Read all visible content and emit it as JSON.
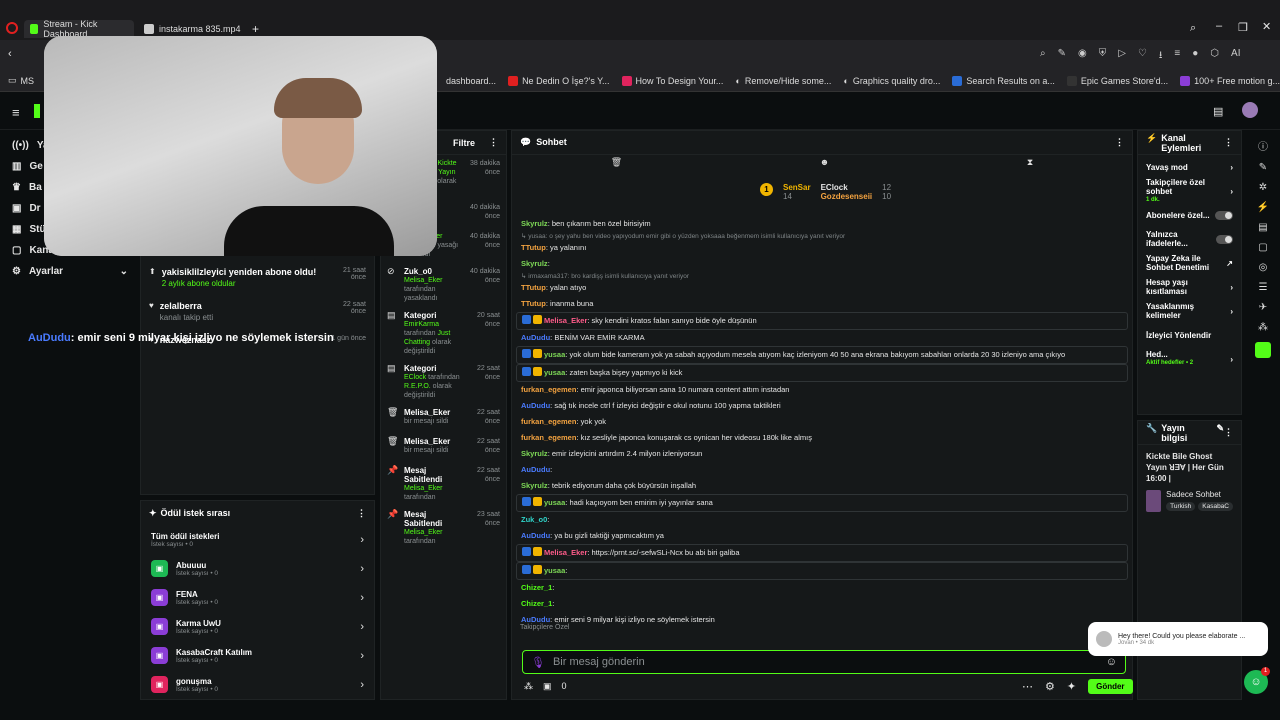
{
  "browser": {
    "tabs": [
      {
        "label": "Stream - Kick Dashboard",
        "active": true
      },
      {
        "label": "instakarma 835.mp4",
        "active": false
      }
    ],
    "bookmarks": [
      "MS",
      "dashboard...",
      "Ne Dedin O İşe?'s Y...",
      "How To Design Your...",
      "Remove/Hide some...",
      "Graphics quality dro...",
      "Search Results on a...",
      "Epic Games Store'd...",
      "100+ Free motion g..."
    ],
    "ai_label": "AI"
  },
  "leftnav": {
    "items": [
      {
        "label": "Ya",
        "icon": "broadcast-icon"
      },
      {
        "label": "Ge",
        "icon": "stats-icon"
      },
      {
        "label": "Ba",
        "icon": "trophy-icon"
      },
      {
        "label": "Dr",
        "icon": "drops-icon"
      },
      {
        "label": "Stü",
        "icon": "studio-icon"
      },
      {
        "label": "Kanal",
        "icon": "channel-icon"
      }
    ],
    "settings_label": "Ayarlar"
  },
  "overlay_caption": {
    "user": "AuDudu",
    "text": ": emir seni 9 milyar kişi izliyo ne söylemek istersin"
  },
  "activity_left": [
    {
      "name": "yakisiklilzleyici yeniden abone oldu!",
      "sub": "2 aylık abone oldular",
      "time": "21 saat önce",
      "icon": "subscribe-icon"
    },
    {
      "name": "zelalberra",
      "sub": "kanalı takip etti",
      "time": "22 saat önce",
      "icon": "heart-icon"
    },
    {
      "name": "nazweznasz",
      "sub": "",
      "time": "1 gün önce",
      "icon": "heart-icon"
    }
  ],
  "modlog": {
    "filter_label": "Filtre",
    "entries": [
      {
        "title": "",
        "by": "",
        "action": "tarafından",
        "target": "Kickte Bile Ghost Yayın ꓤƎⱯ | Her",
        "extra": "olarak değiştirildi",
        "time": "38 dakika önce"
      },
      {
        "title": "",
        "by": "",
        "action": "",
        "target": "",
        "extra": "",
        "time": "40 dakika önce"
      },
      {
        "title": "",
        "by": "Melisa_Eker",
        "action": "tarafından yasağı",
        "target": "",
        "extra": "kaldırıldı",
        "time": "40 dakika önce"
      },
      {
        "title": "Zuk_o0",
        "by": "Melisa_Eker",
        "action": "tarafından",
        "target": "",
        "extra": "yasaklandı",
        "time": "40 dakika önce",
        "icon": "ban-icon"
      },
      {
        "title": "Kategori",
        "by": "EmirKarma",
        "action": "tarafından",
        "target": "Just Chatting",
        "extra": "olarak değiştirildi",
        "time": "20 saat önce",
        "icon": "category-icon"
      },
      {
        "title": "Kategori",
        "by": "EClock",
        "action": "tarafından",
        "target": "R.E.P.O.",
        "extra": "olarak değiştirildi",
        "time": "22 saat önce",
        "icon": "category-icon"
      },
      {
        "title": "Melisa_Eker",
        "by": "",
        "action": "bir mesajı sildi",
        "target": "",
        "extra": "",
        "time": "22 saat önce",
        "icon": "trash-icon"
      },
      {
        "title": "Melisa_Eker",
        "by": "",
        "action": "bir mesajı sildi",
        "target": "",
        "extra": "",
        "time": "22 saat önce",
        "icon": "trash-icon"
      },
      {
        "title": "Mesaj Sabitlendi",
        "by": "Melisa_Eker",
        "action": "tarafından",
        "target": "",
        "extra": "",
        "time": "22 saat önce",
        "icon": "pin-icon"
      },
      {
        "title": "Mesaj Sabitlendi",
        "by": "Melisa_Eker",
        "action": "tarafından",
        "target": "",
        "extra": "",
        "time": "23 saat önce",
        "icon": "pin-icon"
      }
    ]
  },
  "rewards": {
    "title": "Ödül istek sırası",
    "items": [
      {
        "name": "Tüm ödül istekleri",
        "count": "İstek sayısı • 0",
        "color": ""
      },
      {
        "name": "Abuuuu",
        "count": "İstek sayısı • 0",
        "color": "#1db954"
      },
      {
        "name": "FENA",
        "count": "İstek sayısı • 0",
        "color": "#8b3dd6"
      },
      {
        "name": "Karma UwU",
        "count": "İstek sayısı • 0",
        "color": "#8b3dd6"
      },
      {
        "name": "KasabaCraft Katılım",
        "count": "İstek sayısı • 0",
        "color": "#8b3dd6"
      },
      {
        "name": "gonuşma",
        "count": "İstek sayısı • 0",
        "color": "#e0245e"
      }
    ]
  },
  "chat": {
    "title": "Sohbet",
    "leaderboard": [
      {
        "name": "SenSar",
        "points": "14"
      },
      {
        "name": "EClock",
        "points": "12"
      },
      {
        "name": "Gozdesenseii",
        "points": "10"
      }
    ],
    "messages": [
      {
        "user": "Skyrulz",
        "color": "#7ed957",
        "text": ": ben çıkarım ben özel birisiyim"
      },
      {
        "reply": "↳ yusaa: o şey yahu ben video yapıyodum emir gibi o yüzden yoksaaa beğenmem isimli kullanıcıya yanıt veriyor"
      },
      {
        "user": "TTutup",
        "color": "#f4a340",
        "text": ": ya yalanını"
      },
      {
        "user": "Skyrulz",
        "color": "#7ed957",
        "text": ":"
      },
      {
        "reply": "↳ irmaxama317: bro kardişş isimli kullanıcıya yanıt veriyor"
      },
      {
        "user": "TTutup",
        "color": "#f4a340",
        "text": ": yalan atıyo"
      },
      {
        "user": "TTutup",
        "color": "#f4a340",
        "text": ": inanma buna"
      },
      {
        "user": "Melisa_Eker",
        "color": "#ff5c8a",
        "text": ": sky kendini kratos falan sanıyo bide öyle düşünün",
        "hl": true
      },
      {
        "user": "AuDudu",
        "color": "#4a7bff",
        "text": ": BENİM VAR EMİR KARMA"
      },
      {
        "user": "yusaa",
        "color": "#7ed957",
        "text": ": yok olum bide kameram yok ya sabah açıyodum mesela atıyom kaç izleniyom 40 50 ana ekrana bakıyom sabahları onlarda 20 30 izleniyo ama çıkıyo",
        "hl": true
      },
      {
        "user": "yusaa",
        "color": "#7ed957",
        "text": ": zaten başka bişey yapmıyo ki kick",
        "hl": true
      },
      {
        "user": "furkan_egemen",
        "color": "#f4a340",
        "text": ": emir japonca biliyorsan sana 10 numara content attım instadan"
      },
      {
        "user": "AuDudu",
        "color": "#4a7bff",
        "text": ": sağ tık incele ctrl f izleyici değiştir e okul notunu 100 yapma taktikleri"
      },
      {
        "user": "furkan_egemen",
        "color": "#f4a340",
        "text": ": yok yok"
      },
      {
        "user": "furkan_egemen",
        "color": "#f4a340",
        "text": ": kız sesliyle japonca konuşarak cs oynican her videosu 180k like almış"
      },
      {
        "user": "Skyrulz",
        "color": "#7ed957",
        "text": ": emir izleyicini artırdım 2.4 milyon izleniyorsun"
      },
      {
        "user": "AuDudu",
        "color": "#4a7bff",
        "text": ":"
      },
      {
        "user": "Skyrulz",
        "color": "#7ed957",
        "text": ": tebrik ediyorum daha çok büyürsün inşallah"
      },
      {
        "user": "yusaa",
        "color": "#7ed957",
        "text": ": hadi kaçıoyom ben emirim iyi yayınlar sana",
        "hl": true
      },
      {
        "user": "Zuk_o0",
        "color": "#2fd3c9",
        "text": ":"
      },
      {
        "user": "AuDudu",
        "color": "#4a7bff",
        "text": ": ya bu gizli taktiği yapmıcaktım ya"
      },
      {
        "user": "Melisa_Eker",
        "color": "#ff5c8a",
        "text": ": https://prnt.sc/-sefwSLi-Ncx bu abi biri galiba",
        "hl": true
      },
      {
        "user": "yusaa",
        "color": "#7ed957",
        "text": ":",
        "hl": true
      },
      {
        "user": "Chizer_1",
        "color": "#53fc18",
        "text": ":"
      },
      {
        "user": "Chizer_1",
        "color": "#53fc18",
        "text": ":"
      },
      {
        "user": "AuDudu",
        "color": "#4a7bff",
        "text": ": emir seni 9 milyar kişi izliyo ne söylemek istersin"
      }
    ],
    "followers_label": "Takipçilere Özel",
    "input_placeholder": "Bir mesaj gönderin",
    "count": "0",
    "send_label": "Gönder"
  },
  "channel_actions": {
    "title": "Kanal Eylemleri",
    "items": [
      {
        "label": "Yavaş mod",
        "sub": "",
        "control": "arrow"
      },
      {
        "label": "Takipçilere özel sohbet",
        "sub": "1 dk.",
        "control": "arrow"
      },
      {
        "label": "Abonelere özel...",
        "sub": "",
        "control": "toggle"
      },
      {
        "label": "Yalnızca ifadelerle...",
        "sub": "",
        "control": "toggle"
      },
      {
        "label": "Yapay Zeka ile Sohbet Denetimi",
        "sub": "",
        "control": "link"
      },
      {
        "label": "Hesap yaşı kısıtlaması",
        "sub": "",
        "control": "arrow"
      },
      {
        "label": "Yasaklanmış kelimeler",
        "sub": "",
        "control": "arrow"
      },
      {
        "label": "İzleyici Yönlendir",
        "sub": "",
        "control": "none"
      },
      {
        "label": "Hed...",
        "sub": "Aktif hedefler • 2",
        "control": "arrow"
      }
    ]
  },
  "stream_info": {
    "title": "Yayın bilgisi",
    "stream_title": "Kickte Bile Ghost Yayın ꓤƎⱯ | Her Gün 16:00 |",
    "chat_mode": "Sadece Sohbet",
    "tags": [
      "Turkish",
      "KasabaC"
    ]
  },
  "notification": {
    "text": "Hey there!  Could you please elaborate ...",
    "meta": "Jovan • 34 dk"
  },
  "chat_launcher_badge": "1",
  "colors": {
    "accent": "#53fc18",
    "bg": "#0b0e0f",
    "panel": "#151819"
  }
}
